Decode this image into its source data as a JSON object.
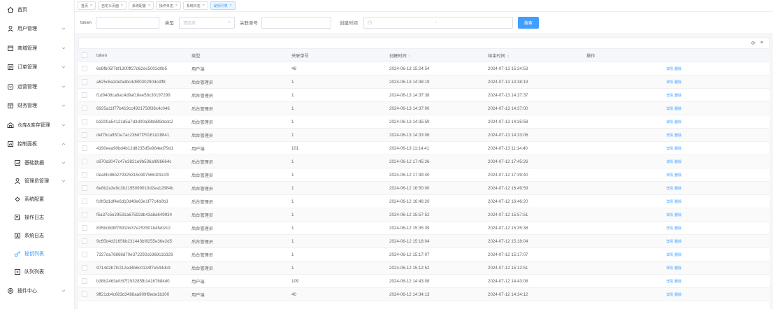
{
  "sidebar": {
    "items": [
      {
        "label": "首页",
        "icon": "home-icon",
        "arrow": false
      },
      {
        "label": "用户管理",
        "icon": "user-icon",
        "arrow": true
      },
      {
        "label": "商城管理",
        "icon": "shop-icon",
        "arrow": true
      },
      {
        "label": "订单管理",
        "icon": "order-icon",
        "arrow": true
      },
      {
        "label": "运营管理",
        "icon": "operation-icon",
        "arrow": true
      },
      {
        "label": "财务管理",
        "icon": "finance-icon",
        "arrow": true
      },
      {
        "label": "仓库&库存管理",
        "icon": "warehouse-icon",
        "arrow": true
      },
      {
        "label": "控制面板",
        "icon": "dashboard-icon",
        "arrow": true,
        "expanded": true
      }
    ],
    "sub_items": [
      {
        "label": "基础数据",
        "icon": "data-icon",
        "arrow": true
      },
      {
        "label": "管理员管理",
        "icon": "admin-icon",
        "arrow": true
      },
      {
        "label": "系统配置",
        "icon": "config-icon",
        "arrow": false
      },
      {
        "label": "操作日志",
        "icon": "operation-log-icon",
        "arrow": false
      },
      {
        "label": "系统日志",
        "icon": "system-log-icon",
        "arrow": false
      },
      {
        "label": "秘钥列表",
        "icon": "key-icon",
        "arrow": false,
        "active": true
      },
      {
        "label": "队列列表",
        "icon": "queue-icon",
        "arrow": false
      }
    ],
    "plugin": {
      "label": "插件中心",
      "icon": "plugin-icon",
      "arrow": true
    }
  },
  "tabs": [
    {
      "label": "首页",
      "active": false
    },
    {
      "label": "自定义页面",
      "active": false
    },
    {
      "label": "系统配置",
      "active": false
    },
    {
      "label": "操作日志",
      "active": false
    },
    {
      "label": "系统日志",
      "active": false
    },
    {
      "label": "秘钥列表",
      "active": true
    }
  ],
  "search": {
    "token_label": "token",
    "token_placeholder": "",
    "type_label": "类型",
    "type_placeholder": "请选择",
    "order_label": "关联单号",
    "order_placeholder": "",
    "time_label": "创建时间",
    "time_separator": "-",
    "search_button": "搜索"
  },
  "table": {
    "columns": [
      "token",
      "类型",
      "关联单号",
      "创建时间",
      "结束时间",
      "操作"
    ],
    "actions": {
      "detail": "详情",
      "delete": "删除"
    },
    "rows": [
      {
        "token": "6d8fb05f7bf1300ff27d62ec5002d0b5",
        "type": "用户端",
        "order": "48",
        "created": "2024-06-13 15:24:54",
        "ended": "2024-07-13 15:24:53"
      },
      {
        "token": "a625c6a2defadbc4d5f030290dcdff8",
        "type": "后台管理员",
        "order": "1",
        "created": "2024-06-13 14:38:19",
        "ended": "2024-07-13 14:38:19"
      },
      {
        "token": "f1d9408ca8ac4d9af18ee58c30197299",
        "type": "后台管理员",
        "order": "1",
        "created": "2024-06-13 14:37:38",
        "ended": "2024-07-13 14:37:37"
      },
      {
        "token": "6925a11f77b419cc4921758f38c4c046",
        "type": "后台管理员",
        "order": "1",
        "created": "2024-06-13 14:37:00",
        "ended": "2024-07-13 14:37:00"
      },
      {
        "token": "b3200a54121d5a7d3d00a38b889dcdc2",
        "type": "后台管理员",
        "order": "1",
        "created": "2024-06-13 14:35:59",
        "ended": "2024-07-13 14:35:58"
      },
      {
        "token": "def7bca95f1e7ac236d7f79161d28841",
        "type": "后台管理员",
        "order": "1",
        "created": "2024-06-13 14:33:06",
        "ended": "2024-07-13 14:33:06"
      },
      {
        "token": "4190eea90bd4b12d8235d5e964ed79d1",
        "type": "用户端",
        "order": "101",
        "created": "2024-06-13 11:14:41",
        "ended": "2024-07-13 11:14:40"
      },
      {
        "token": "c870a3047c47e3821e9b536af896664c",
        "type": "后台管理员",
        "order": "1",
        "created": "2024-06-12 17:45:26",
        "ended": "2024-07-12 17:45:26"
      },
      {
        "token": "0ea5fc86b279325315c9975661f41cf0",
        "type": "后台管理员",
        "order": "1",
        "created": "2024-06-12 17:39:40",
        "ended": "2024-07-12 17:39:40"
      },
      {
        "token": "6e8b2a3e9c3b2195099010d2ea12884b",
        "type": "后台管理员",
        "order": "1",
        "created": "2024-06-12 16:50:00",
        "ended": "2024-07-12 16:49:59"
      },
      {
        "token": "fc9f3d1df4e6d10d48e63e1f77c4b0b3",
        "type": "后台管理员",
        "order": "1",
        "created": "2024-06-12 16:46:20",
        "ended": "2024-07-12 16:46:20"
      },
      {
        "token": "f5a37c5e29531a67592db43a8a649934",
        "type": "后台管理员",
        "order": "1",
        "created": "2024-06-12 15:57:52",
        "ended": "2024-07-12 15:57:51"
      },
      {
        "token": "835bc8d8f7891bb37e253501b4feb2c2",
        "type": "后台管理员",
        "order": "1",
        "created": "2024-06-12 15:35:39",
        "ended": "2024-07-12 15:35:38"
      },
      {
        "token": "9c65b4d31656b231443bf8255e36e2d5",
        "type": "后台管理员",
        "order": "1",
        "created": "2024-06-12 15:18:04",
        "ended": "2024-07-12 15:18:04"
      },
      {
        "token": "7327da78868d70e372292c6368c1b326",
        "type": "后台管理员",
        "order": "1",
        "created": "2024-06-12 15:17:07",
        "ended": "2024-07-12 15:17:07"
      },
      {
        "token": "9714d2b7fc212ed4b6c0134f7e544dc9",
        "type": "后台管理员",
        "order": "1",
        "created": "2024-06-12 15:12:52",
        "ended": "2024-07-12 15:12:51"
      },
      {
        "token": "b38b2463efc67f193285fb14167684d0",
        "type": "用户端",
        "order": "109",
        "created": "2024-06-12 14:43:08",
        "ended": "2024-07-12 14:43:08"
      },
      {
        "token": "9ff21cb4c663d3488aa909f8ede1b300",
        "type": "用户端",
        "order": "40",
        "created": "2024-06-12 14:34:13",
        "ended": "2024-07-12 14:34:12"
      }
    ]
  },
  "toolbar": {
    "refresh_icon": "refresh-icon",
    "columns_icon": "filter-icon"
  },
  "colors": {
    "accent": "#409eff",
    "sidebar_bg": "#ffffff",
    "page_bg": "#f5f6f8"
  }
}
